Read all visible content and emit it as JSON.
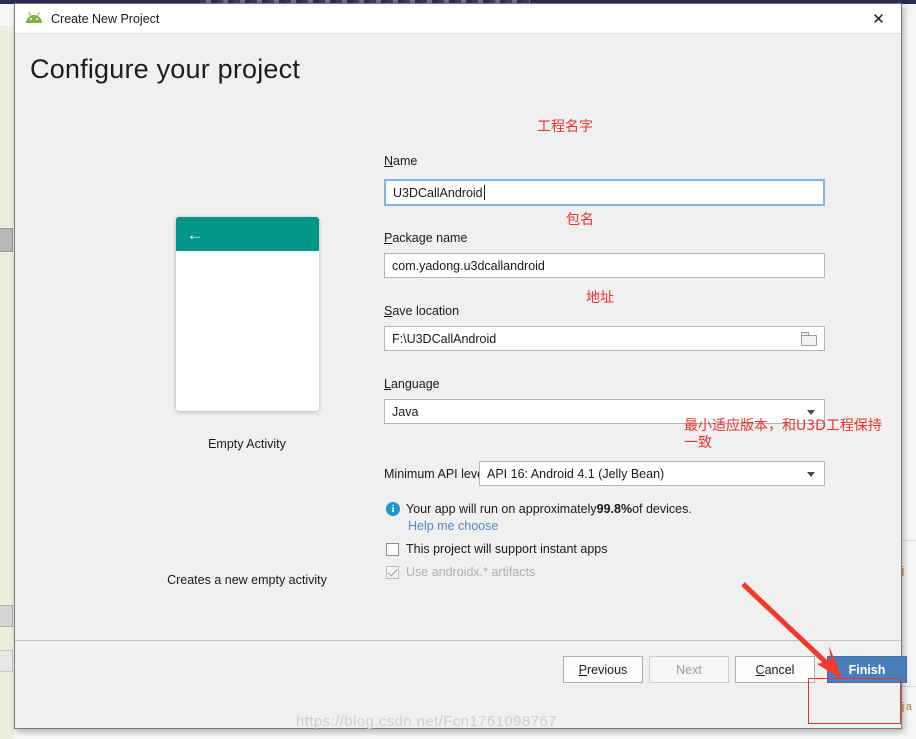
{
  "window": {
    "title": "Create New Project",
    "close_label": "✕",
    "app_icon": "android-icon"
  },
  "page": {
    "heading": "Configure your project"
  },
  "preview": {
    "template_name": "Empty Activity",
    "template_description": "Creates a new empty activity",
    "appbar_color": "#009688",
    "back_icon": "←"
  },
  "form": {
    "name": {
      "label_mnemonic": "N",
      "label_rest": "ame",
      "value": "U3DCallAndroid",
      "focused": true
    },
    "package_name": {
      "label_mnemonic": "P",
      "label_rest": "ackage name",
      "value": "com.yadong.u3dcallandroid"
    },
    "save_location": {
      "label_mnemonic": "S",
      "label_rest": "ave location",
      "value": "F:\\U3DCallAndroid",
      "browse_icon": "folder-icon"
    },
    "language": {
      "label_mnemonic": "L",
      "label_rest": "anguage",
      "value": "Java"
    },
    "minimum_api_level": {
      "label": "Minimum API level",
      "value": "API 16: Android 4.1 (Jelly Bean)"
    },
    "device_coverage": {
      "prefix": "Your app will run on approximately ",
      "percent": "99.8%",
      "suffix": " of devices."
    },
    "help_link": "Help me choose",
    "instant_apps": {
      "label": "This project will support instant apps",
      "checked": false
    },
    "androidx": {
      "label": "Use androidx.* artifacts",
      "checked": true,
      "disabled": true
    }
  },
  "footer": {
    "previous": {
      "mnemonic": "P",
      "rest": "revious"
    },
    "next": {
      "label": "Next",
      "enabled": false
    },
    "cancel": {
      "mnemonic": "C",
      "rest": "ancel"
    },
    "finish": {
      "label": "Finish",
      "primary": true,
      "accent": "#4a7ebb"
    }
  },
  "annotations": {
    "color": "#e8332a",
    "name_note": "工程名字",
    "package_note": "包名",
    "location_note": "地址",
    "api_note": "最小适应版本，和U3D工程保持\n一致",
    "arrow": "red-arrow-pointing-to-finish",
    "highlight_box": "finish-button-highlight"
  },
  "watermark": {
    "text": "https://blog.csdn.net/Fcn1761098767"
  },
  "background": {
    "code_fragment_1": "j",
    "code_fragment_2": "ja"
  }
}
